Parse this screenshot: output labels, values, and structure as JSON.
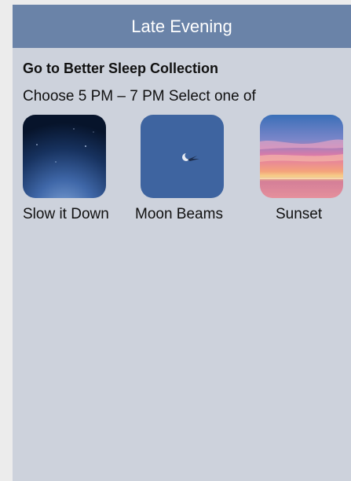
{
  "header": {
    "title": "Late Evening"
  },
  "collection": {
    "title": "Go to Better Sleep Collection",
    "instruction": "Choose 5 PM – 7 PM Select one of"
  },
  "options": [
    {
      "label": "Slow it Down",
      "icon": "night-sky-thumbnail"
    },
    {
      "label": "Moon Beams",
      "icon": "moon-thumbnail"
    },
    {
      "label": "Sunset",
      "icon": "sunset-thumbnail"
    }
  ],
  "colors": {
    "header_bg": "#6a83a8",
    "panel_bg": "#cdd2dc"
  }
}
